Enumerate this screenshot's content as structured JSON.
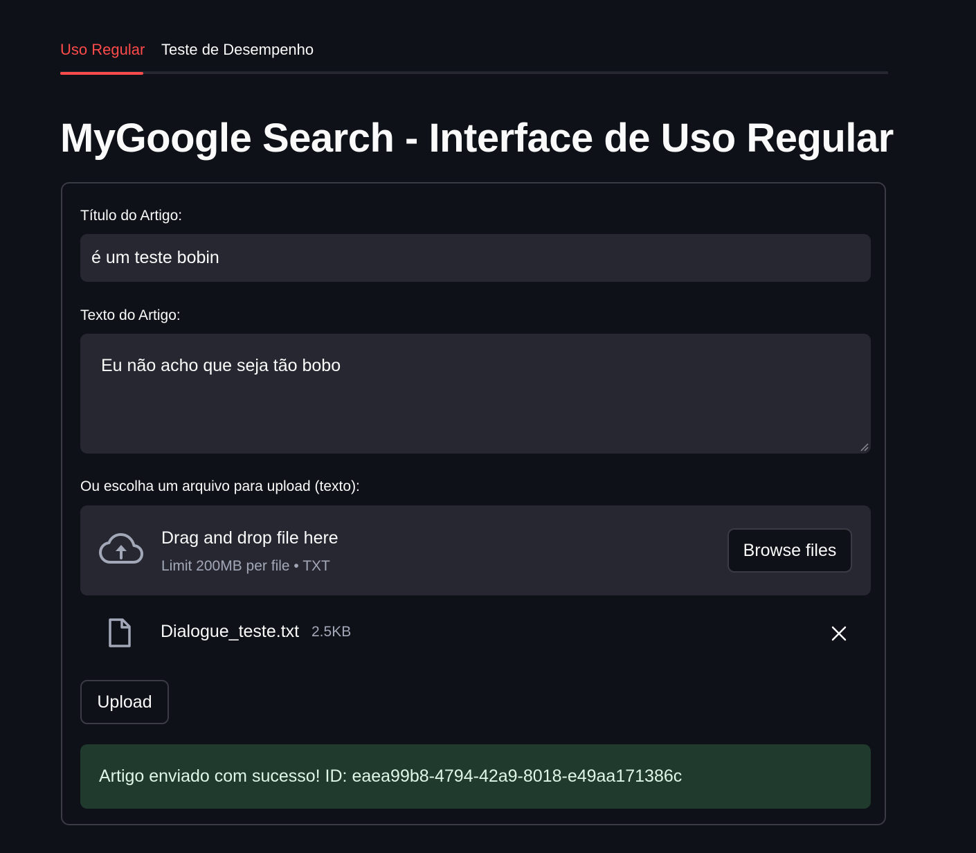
{
  "tabs": [
    {
      "label": "Uso Regular",
      "active": true
    },
    {
      "label": "Teste de Desempenho",
      "active": false
    }
  ],
  "page": {
    "title": "MyGoogle Search - Interface de Uso Regular"
  },
  "form": {
    "title_label": "Título do Artigo:",
    "title_value": "é um teste bobin",
    "text_label": "Texto do Artigo:",
    "text_value": "Eu não acho que seja tão bobo",
    "upload_label": "Ou escolha um arquivo para upload (texto):",
    "dropzone": {
      "icon": "cloud-upload-icon",
      "title": "Drag and drop file here",
      "subtitle": "Limit 200MB per file • TXT",
      "browse_label": "Browse files"
    },
    "uploaded_file": {
      "icon": "file-icon",
      "name": "Dialogue_teste.txt",
      "size": "2.5KB"
    },
    "upload_button_label": "Upload",
    "success_message": "Artigo enviado com sucesso! ID: eaea99b8-4794-42a9-8018-e49aa171386c"
  },
  "colors": {
    "background": "#0e1117",
    "accent": "#ff4b4b",
    "input_background": "#262730",
    "success_background": "#203a2d"
  }
}
